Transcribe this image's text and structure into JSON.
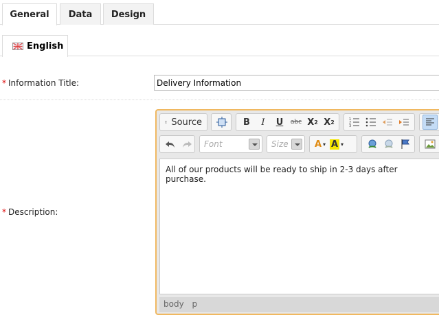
{
  "tabs": [
    {
      "label": "General",
      "active": true
    },
    {
      "label": "Data",
      "active": false
    },
    {
      "label": "Design",
      "active": false
    }
  ],
  "language_tab": {
    "label": "English",
    "icon": "uk-flag-icon"
  },
  "required_marker": "*",
  "fields": {
    "title_label": "Information Title:",
    "title_value": "Delivery Information",
    "description_label": "Description:"
  },
  "editor": {
    "source_label": "Source",
    "font_placeholder": "Font",
    "size_placeholder": "Size",
    "body_text": "All of our products will be ready to ship in 2-3 days after purchase.",
    "path": [
      "body",
      "p"
    ],
    "accent_border": "#f0b860"
  }
}
